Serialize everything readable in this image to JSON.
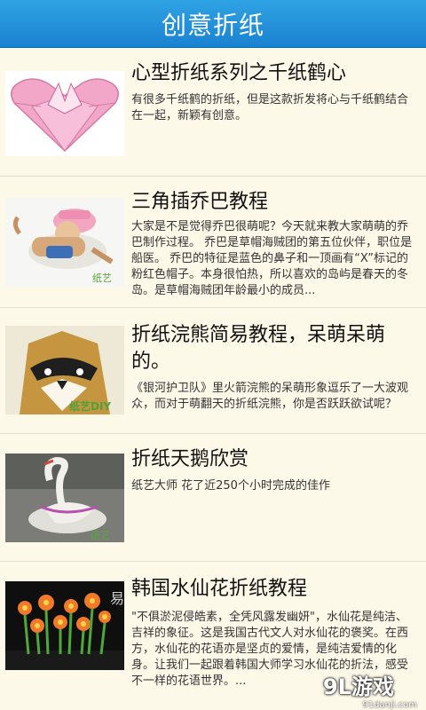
{
  "header": {
    "title": "创意折纸"
  },
  "items": [
    {
      "title": "心型折纸系列之千纸鹤心",
      "desc": "有很多千纸鹤的折纸，但是这款折发将心与千纸鹤结合在一起，新颖有创意。",
      "thumb_icon": "paper-heart-crane-image"
    },
    {
      "title": "三角插乔巴教程",
      "desc": "大家是不是觉得乔巴很萌呢？今天就来教大家萌萌的乔巴制作过程。 乔巴是草帽海贼团的第五位伙伴，职位是船医。 乔巴的特征是蓝色的鼻子和一顶画有“X”标记的粉红色帽子。本身很怕热，所以喜欢的岛屿是春天的冬岛。是草帽海贼团年龄最小的成员...",
      "thumb_icon": "chopper-origami-image",
      "thumb_caption": "纸艺"
    },
    {
      "title": "折纸浣熊简易教程，呆萌呆萌的。",
      "desc": "《银河护卫队》里火箭浣熊的呆萌形象逗乐了一大波观众，而对于萌翻天的折纸浣熊，你是否跃跃欲试呢？",
      "thumb_icon": "raccoon-origami-image",
      "thumb_caption": "纸艺DIY"
    },
    {
      "title": "折纸天鹅欣赏",
      "desc": "纸艺大师 花了近250个小时完成的佳作",
      "thumb_icon": "swan-origami-image",
      "thumb_caption": "纸艺"
    },
    {
      "title": "韩国水仙花折纸教程",
      "desc": "\"不俱淤泥侵皓素，全凭风露发幽妍\"，水仙花是纯洁、吉祥的象征。这是我国古代文人对水仙花的褒奖。在西方，水仙花的花语亦是坚贞的爱情，是纯洁爱情的化身。让我们一起跟着韩国大师学习水仙花的折法，感受不一样的花语世界。...",
      "thumb_icon": "narcissus-origami-image",
      "thumb_caption": "易"
    }
  ],
  "watermark": {
    "main": "9L游戏",
    "sub": "91danji.com"
  }
}
